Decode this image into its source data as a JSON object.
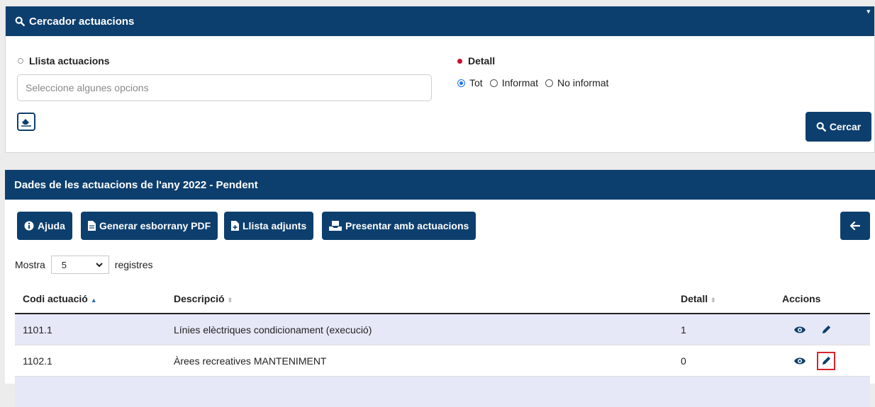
{
  "search_panel": {
    "title": "Cercador actuacions",
    "list_label": "Llista actuacions",
    "select_placeholder": "Seleccione algunes opcions",
    "detail_label": "Detall",
    "radios": [
      {
        "label": "Tot",
        "checked": true
      },
      {
        "label": "Informat",
        "checked": false
      },
      {
        "label": "No informat",
        "checked": false
      }
    ],
    "search_button": "Cercar"
  },
  "table_panel": {
    "title": "Dades de les actuacions de l'any 2022 - Pendent",
    "buttons": {
      "help": "Ajuda",
      "pdf": "Generar esborrany PDF",
      "attachments": "Llista adjunts",
      "present": "Presentar amb actuacions"
    },
    "length": {
      "prefix": "Mostra",
      "value": "5",
      "suffix": "registres"
    },
    "columns": [
      "Codi actuació",
      "Descripció",
      "Detall",
      "Accions"
    ],
    "rows": [
      {
        "code": "1101.1",
        "description": "Línies elèctriques condicionament (execució)",
        "detail": "1"
      },
      {
        "code": "1102.1",
        "description": "Àrees recreatives MANTENIMENT",
        "detail": "0"
      }
    ]
  },
  "colors": {
    "header": "#0d3f6e",
    "row_stripe": "#e7e8f7",
    "highlight": "#d9232d",
    "radio_selected": "#1a73e8"
  }
}
